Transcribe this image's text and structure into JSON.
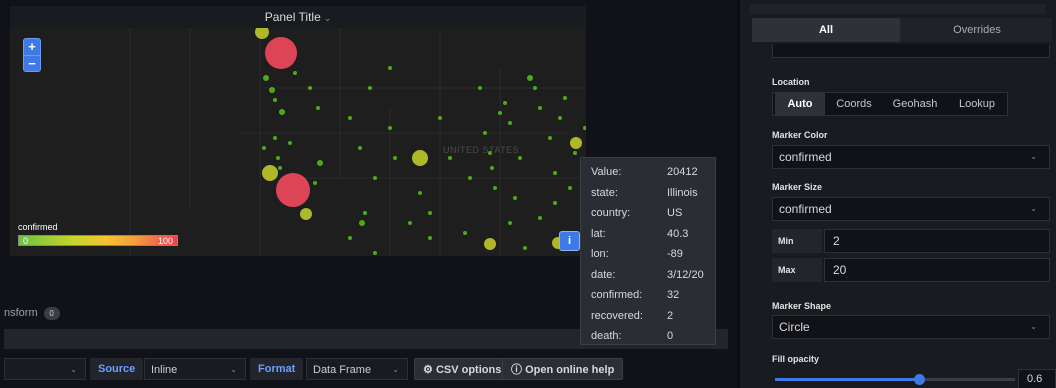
{
  "panel": {
    "title": "Panel Title"
  },
  "map": {
    "zoom_in": "+",
    "zoom_out": "−",
    "country_label": "UNITED STATES",
    "legend": {
      "title": "confirmed",
      "min": "0",
      "max": "100"
    },
    "info_label": "i"
  },
  "tooltip": {
    "rows": [
      {
        "key": "Value:",
        "value": "20412"
      },
      {
        "key": "state:",
        "value": "Illinois"
      },
      {
        "key": "country:",
        "value": "US"
      },
      {
        "key": "lat:",
        "value": "40.3"
      },
      {
        "key": "lon:",
        "value": "-89"
      },
      {
        "key": "date:",
        "value": "3/12/20"
      },
      {
        "key": "confirmed:",
        "value": "32"
      },
      {
        "key": "recovered:",
        "value": "2"
      },
      {
        "key": "death:",
        "value": "0"
      }
    ]
  },
  "transform": {
    "label": "nsform",
    "count": "0"
  },
  "toolbar": {
    "source_label": "Source",
    "source_value": "Inline",
    "format_label": "Format",
    "format_value": "Data Frame",
    "csv_button": "CSV options",
    "help_button": "Open online help"
  },
  "options": {
    "tabs": [
      "All",
      "Overrides"
    ],
    "location": {
      "label": "Location",
      "options": [
        "Auto",
        "Coords",
        "Geohash",
        "Lookup"
      ],
      "selected": "Auto"
    },
    "marker_color": {
      "label": "Marker Color",
      "value": "confirmed"
    },
    "marker_size": {
      "label": "Marker Size",
      "value": "confirmed",
      "min_label": "Min",
      "min": "2",
      "max_label": "Max",
      "max": "20"
    },
    "marker_shape": {
      "label": "Marker Shape",
      "value": "Circle"
    },
    "fill_opacity": {
      "label": "Fill opacity",
      "value": "0.6",
      "fraction": 0.6
    }
  },
  "colors": {
    "accent": "#3d7ae6",
    "marker_small": "#52c41a",
    "marker_mid": "#c8d42a",
    "marker_large": "#f2495c"
  }
}
